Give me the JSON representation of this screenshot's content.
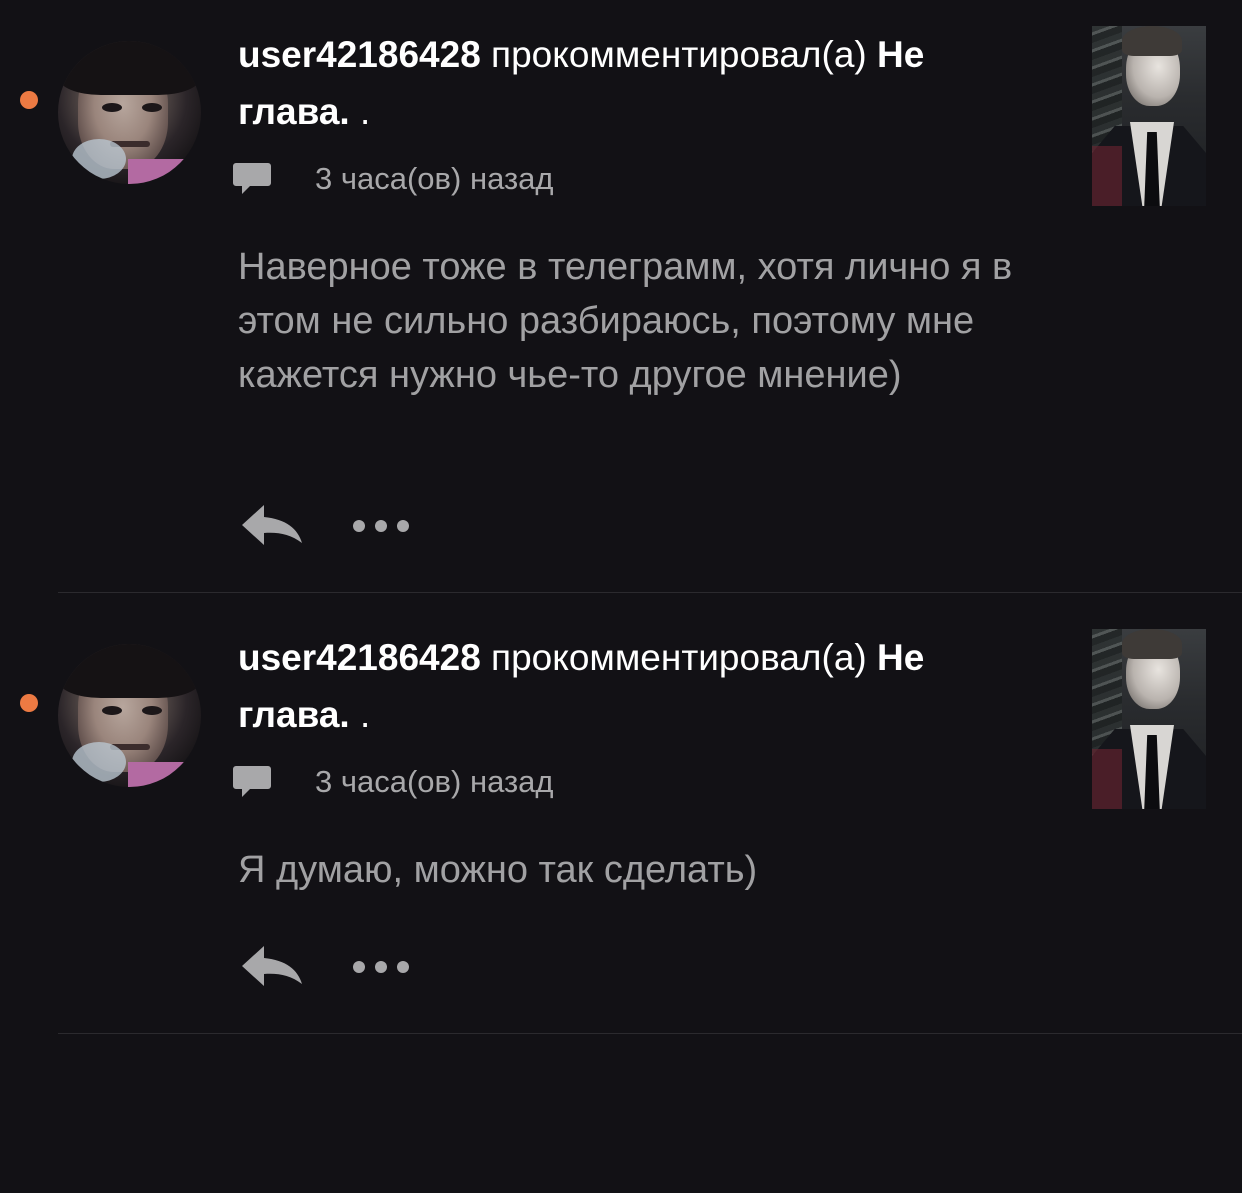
{
  "colors": {
    "background": "#121115",
    "unread_dot": "#ec7a43",
    "primary_text": "#ffffff",
    "secondary_text": "#a1a1a3",
    "icon": "#a8a8aa",
    "divider": "#2b2a2e"
  },
  "notifications": [
    {
      "username": "user42186428",
      "action": " прокомментировал(а) ",
      "story_title": "Не глава.",
      "title_suffix": " .",
      "time": "3 часа(ов) назад",
      "comment": "Наверное тоже в телеграмм, хотя лично я в этом не сильно разбираюсь, поэтому мне кажется нужно чье-то другое мнение)",
      "icons": {
        "unread": "unread-dot",
        "type": "comment-bubble-icon",
        "reply": "reply-arrow-icon",
        "more": "more-options-icon"
      }
    },
    {
      "username": "user42186428",
      "action": " прокомментировал(а) ",
      "story_title": "Не глава.",
      "title_suffix": " .",
      "time": "3 часа(ов) назад",
      "comment": "Я думаю, можно так сделать)",
      "icons": {
        "unread": "unread-dot",
        "type": "comment-bubble-icon",
        "reply": "reply-arrow-icon",
        "more": "more-options-icon"
      }
    }
  ]
}
